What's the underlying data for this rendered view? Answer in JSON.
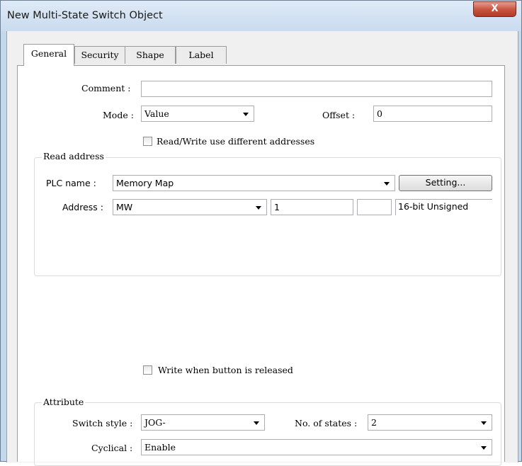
{
  "window": {
    "title": "New Multi-State Switch Object",
    "close_glyph": "X"
  },
  "tabs": [
    {
      "label": "General"
    },
    {
      "label": "Security"
    },
    {
      "label": "Shape"
    },
    {
      "label": "Label"
    }
  ],
  "general": {
    "comment_label": "Comment :",
    "comment_value": "",
    "mode_label": "Mode :",
    "mode_value": "Value",
    "offset_label": "Offset :",
    "offset_value": "0",
    "rw_diff_label": "Read/Write use different addresses",
    "rw_diff_checked": false
  },
  "read_address": {
    "group_title": "Read address",
    "plc_name_label": "PLC name :",
    "plc_name_value": "Memory Map",
    "setting_button": "Setting...",
    "address_label": "Address :",
    "address_type": "MW",
    "address_value": "1",
    "address_extra": "",
    "data_format": "16-bit Unsigned"
  },
  "write_release": {
    "label": "Write when button is released",
    "checked": false
  },
  "attribute": {
    "group_title": "Attribute",
    "switch_style_label": "Switch style :",
    "switch_style_value": "JOG-",
    "states_label": "No. of states :",
    "states_value": "2",
    "cyclical_label": "Cyclical :",
    "cyclical_value": "Enable"
  }
}
